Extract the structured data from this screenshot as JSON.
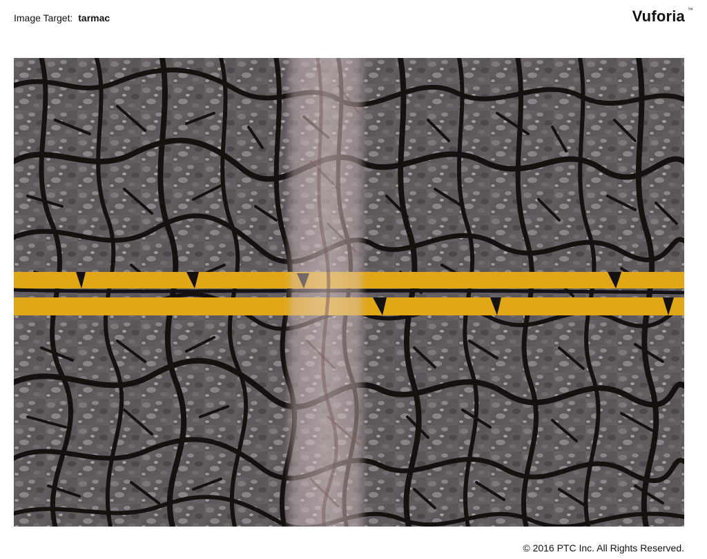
{
  "header": {
    "label": "Image Target:",
    "target_name": "tarmac"
  },
  "brand": {
    "name": "Vuforia",
    "trademark": "™"
  },
  "target_image": {
    "description_icon": "cracked-asphalt-image",
    "colors": {
      "asphalt": "#5f5a5e",
      "cracks": "#14110f",
      "paint": "#e0a716",
      "tire_track": "#b79494"
    }
  },
  "footer": {
    "copyright": "© 2016 PTC Inc. All Rights Reserved."
  }
}
